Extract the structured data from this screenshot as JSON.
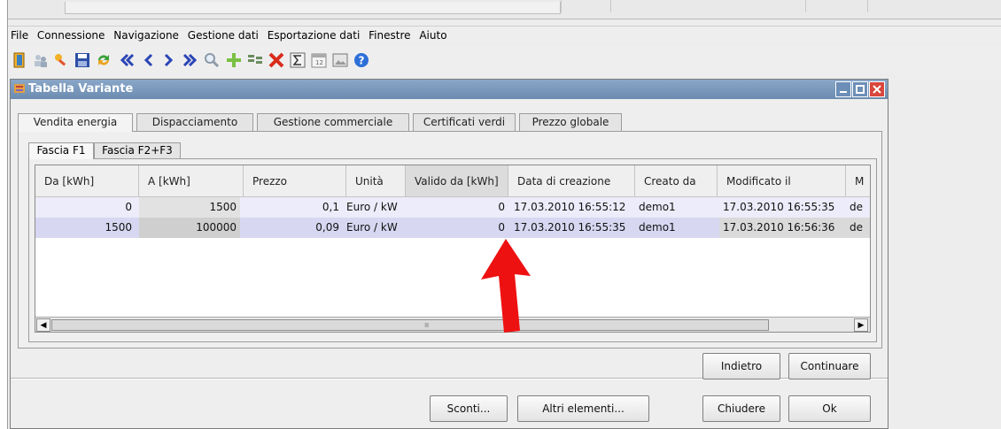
{
  "menu": [
    "File",
    "Connessione",
    "Navigazione",
    "Gestione dati",
    "Esportazione dati",
    "Finestre",
    "Aiuto"
  ],
  "toolbar_icons": [
    "exit-icon",
    "users-icon",
    "key-icon",
    "save-icon",
    "refresh-icon",
    "first-icon",
    "prev-icon",
    "next-icon",
    "last-icon",
    "search-icon",
    "add-icon",
    "split-icon",
    "delete-icon",
    "sum-icon",
    "calendar-icon",
    "image-icon",
    "help-icon"
  ],
  "window": {
    "title": "Tabella Variante"
  },
  "tabs": [
    "Vendita energia",
    "Dispacciamento",
    "Gestione commerciale",
    "Certificati verdi",
    "Prezzo globale"
  ],
  "subtabs": [
    "Fascia F1",
    "Fascia F2+F3"
  ],
  "table": {
    "columns": [
      "Da [kWh]",
      "A [kWh]",
      "Prezzo",
      "Unità",
      "Valido da [kWh]",
      "Data di creazione",
      "Creato da",
      "Modificato il",
      "M"
    ],
    "rows": [
      [
        "0",
        "1500",
        "0,1",
        "Euro / kW",
        "0",
        "17.03.2010 16:55:12",
        "demo1",
        "17.03.2010 16:55:35",
        "de"
      ],
      [
        "1500",
        "100000",
        "0,09",
        "Euro / kW",
        "0",
        "17.03.2010 16:55:35",
        "demo1",
        "17.03.2010 16:56:36",
        "de"
      ]
    ],
    "scroll_mark": "IIII"
  },
  "buttons": {
    "back": "Indietro",
    "continue": "Continuare",
    "discounts": "Sconti...",
    "other": "Altri elementi...",
    "close": "Chiudere",
    "ok": "Ok"
  },
  "colors": {
    "title_bar": "#7894ba",
    "row1": "#e9e9fb",
    "row2": "#d6d6f0",
    "annotation_arrow": "#ee1111"
  }
}
